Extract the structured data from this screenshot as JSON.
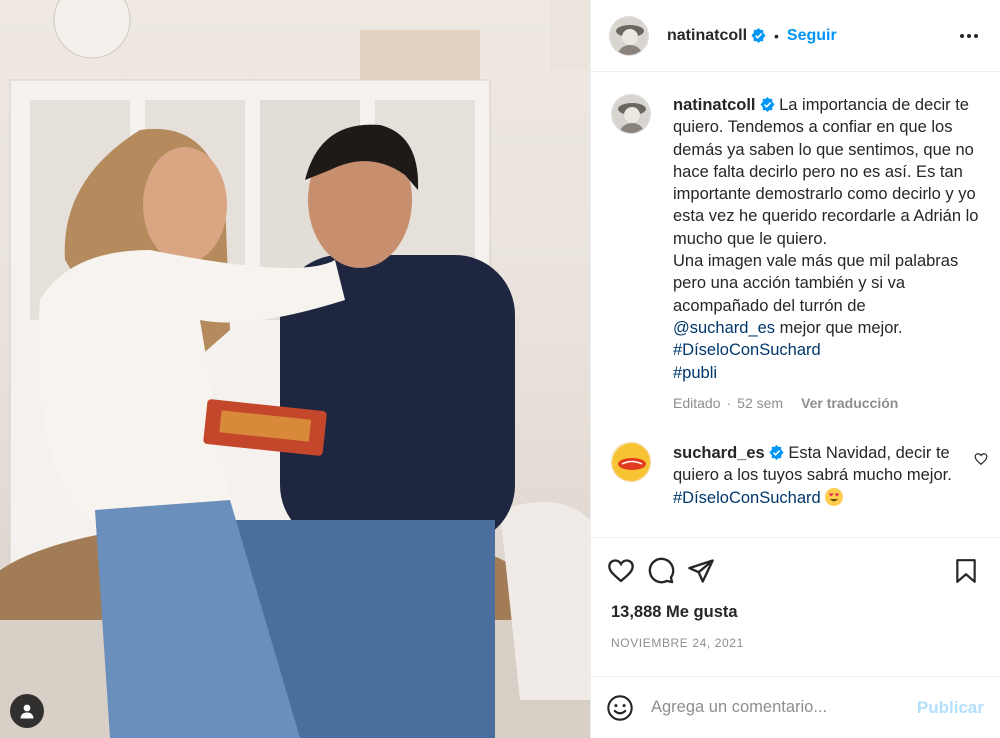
{
  "header": {
    "username": "natinatcoll",
    "separator": "•",
    "follow_label": "Seguir"
  },
  "caption": {
    "username": "natinatcoll",
    "text_1": "La importancia de decir te quiero. Tendemos a confiar en que los demás ya saben lo que sentimos, que no hace falta decirlo pero no es así. Es tan importante demostrarlo como decirlo y yo esta vez he querido recordarle a Adrián lo mucho que le quiero.",
    "text_2": "Una imagen vale más que mil palabras pero una acción también y si va acompañado del turrón de",
    "mention": "@suchard_es",
    "text_3": "mejor que mejor.",
    "hashtag_1": "#DíseloConSuchard",
    "hashtag_2": "#publi",
    "edited": "Editado",
    "sep": "·",
    "age": "52 sem",
    "translate_label": "Ver traducción"
  },
  "reply": {
    "username": "suchard_es",
    "text": "Esta Navidad, decir te quiero a los tuyos sabrá mucho mejor.",
    "hashtag": "#DíseloConSuchard"
  },
  "stats": {
    "likes": "13,888 Me gusta",
    "date": "NOVIEMBRE 24, 2021"
  },
  "composer": {
    "placeholder": "Agrega un comentario...",
    "publish_label": "Publicar"
  },
  "colors": {
    "accent": "#0095f6",
    "link": "#00376b",
    "verified": "#0095f6",
    "muted": "#8e8e8e"
  }
}
